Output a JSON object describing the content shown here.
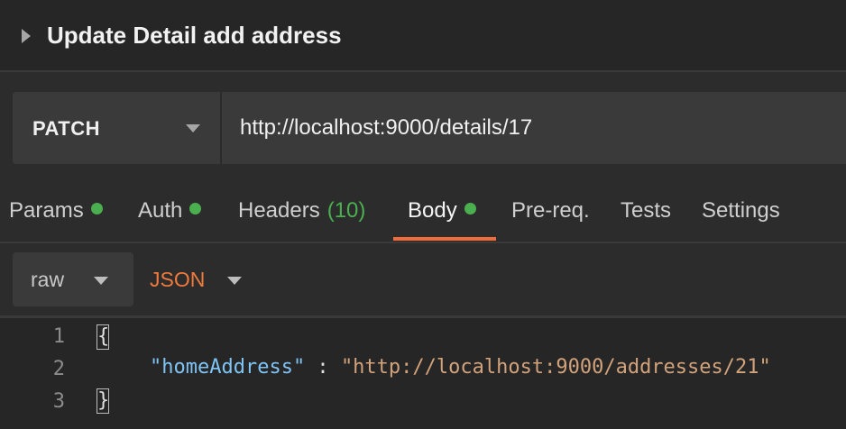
{
  "request": {
    "title": "Update Detail add address",
    "method": "PATCH",
    "url": "http://localhost:9000/details/17"
  },
  "tabs": [
    {
      "label": "Params",
      "dot": true
    },
    {
      "label": "Auth",
      "dot": true
    },
    {
      "label": "Headers",
      "count": "(10)"
    },
    {
      "label": "Body",
      "dot": true,
      "active": true
    },
    {
      "label": "Pre-req."
    },
    {
      "label": "Tests"
    },
    {
      "label": "Settings"
    }
  ],
  "body": {
    "mode": "raw",
    "format": "JSON"
  },
  "editor": {
    "line_numbers": [
      "1",
      "2",
      "3"
    ],
    "open_brace": "{",
    "close_brace": "}",
    "key": "\"homeAddress\"",
    "separator": " : ",
    "value": "\"http://localhost:9000/addresses/21\""
  },
  "colors": {
    "accent": "#f26b3a",
    "status_dot": "#4ab04f",
    "json_key": "#7fc4f5",
    "json_string": "#d2a27b"
  }
}
